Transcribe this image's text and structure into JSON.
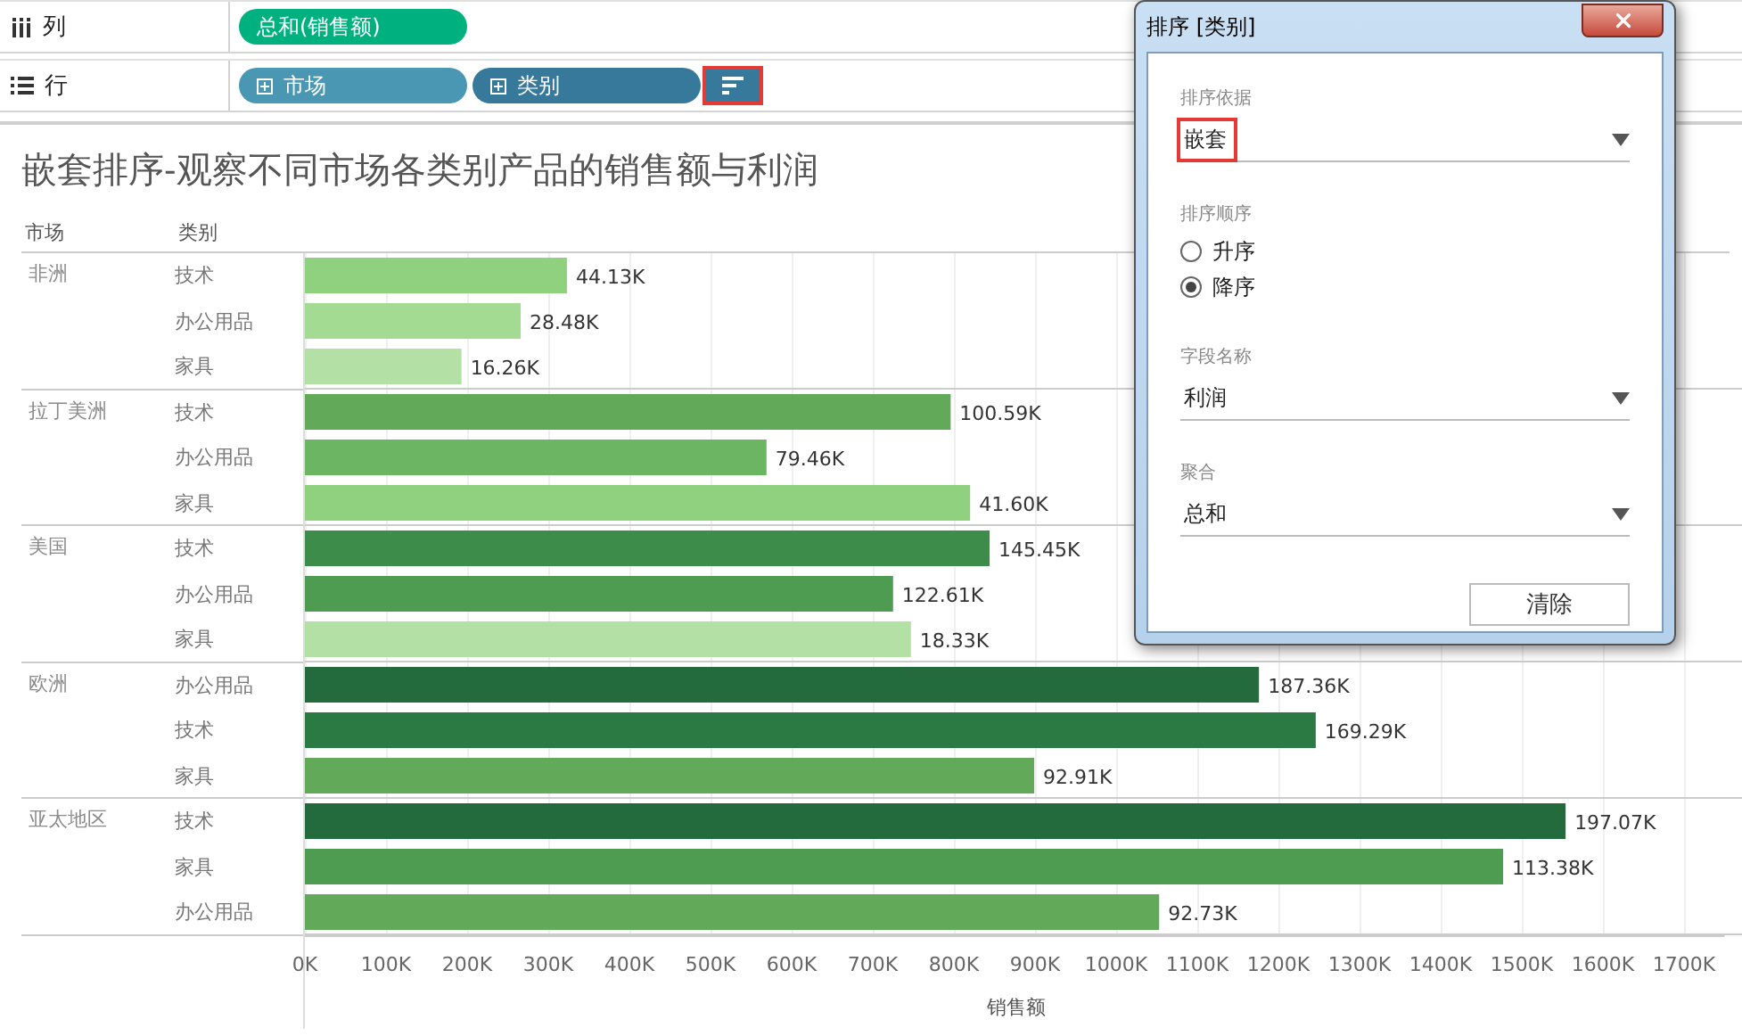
{
  "shelves": [
    {
      "kind": "columns",
      "label": "列",
      "pills": [
        {
          "text": "总和(销售额)",
          "kind": "measure",
          "sort_icon": false
        }
      ]
    },
    {
      "kind": "rows",
      "label": "行",
      "pills": [
        {
          "text": "市场",
          "kind": "dimension",
          "sort_icon": false
        },
        {
          "text": "类别",
          "kind": "dimension",
          "sort_icon": true
        }
      ]
    }
  ],
  "view": {
    "title": "嵌套排序-观察不同市场各类别产品的销售额与利润",
    "row_headers": [
      "市场",
      "类别"
    ],
    "bar_labels": [
      "44.13K",
      "28.48K",
      "16.26K",
      "100.59K",
      "79.46K",
      "41.60K",
      "145.45K",
      "122.61K",
      "18.33K",
      "187.36K",
      "169.29K",
      "92.91K",
      "197.07K",
      "113.38K",
      "92.73K"
    ],
    "groups": [
      {
        "market": "非洲",
        "categories": [
          "技术",
          "办公用品",
          "家具"
        ]
      },
      {
        "market": "拉丁美洲",
        "categories": [
          "技术",
          "办公用品",
          "家具"
        ]
      },
      {
        "market": "美国",
        "categories": [
          "技术",
          "办公用品",
          "家具"
        ]
      },
      {
        "market": "欧洲",
        "categories": [
          "办公用品",
          "技术",
          "家具"
        ]
      },
      {
        "market": "亚太地区",
        "categories": [
          "技术",
          "家具",
          "办公用品"
        ]
      }
    ],
    "chart_data": {
      "type": "bar",
      "orientation": "horizontal",
      "xlabel": "销售额",
      "values": [
        323000,
        266000,
        193000,
        796000,
        569000,
        820000,
        844000,
        725000,
        747000,
        1176000,
        1246000,
        899000,
        1554000,
        1477000,
        1053000
      ],
      "colors": [
        "#8fd17e",
        "#a3db92",
        "#b3e0a5",
        "#63a95a",
        "#6cb563",
        "#8fd17e",
        "#3d8c4a",
        "#4e9c52",
        "#b3e0a5",
        "#236b3c",
        "#2b7a43",
        "#63a95a",
        "#236b3c",
        "#4e9c52",
        "#63a95a"
      ],
      "grid": true,
      "xlim": [
        0,
        1750000
      ],
      "xticks": [
        {
          "value": 0,
          "label": "0K"
        },
        {
          "value": 100000,
          "label": "100K"
        },
        {
          "value": 200000,
          "label": "200K"
        },
        {
          "value": 300000,
          "label": "300K"
        },
        {
          "value": 400000,
          "label": "400K"
        },
        {
          "value": 500000,
          "label": "500K"
        },
        {
          "value": 600000,
          "label": "600K"
        },
        {
          "value": 700000,
          "label": "700K"
        },
        {
          "value": 800000,
          "label": "800K"
        },
        {
          "value": 900000,
          "label": "900K"
        },
        {
          "value": 1000000,
          "label": "1000K"
        },
        {
          "value": 1100000,
          "label": "1100K"
        },
        {
          "value": 1200000,
          "label": "1200K"
        },
        {
          "value": 1300000,
          "label": "1300K"
        },
        {
          "value": 1400000,
          "label": "1400K"
        },
        {
          "value": 1500000,
          "label": "1500K"
        },
        {
          "value": 1600000,
          "label": "1600K"
        },
        {
          "value": 1700000,
          "label": "1700K"
        }
      ]
    }
  },
  "dialog": {
    "title": "排序 [类别]",
    "sections": [
      {
        "kind": "select",
        "label": "排序依据",
        "value": "嵌套",
        "highlighted": true
      },
      {
        "kind": "radio",
        "label": "排序顺序",
        "options": [
          {
            "text": "升序",
            "selected": false
          },
          {
            "text": "降序",
            "selected": true
          }
        ]
      },
      {
        "kind": "select",
        "label": "字段名称",
        "value": "利润",
        "highlighted": false
      },
      {
        "kind": "select",
        "label": "聚合",
        "value": "总和",
        "highlighted": false
      }
    ],
    "button": "清除"
  }
}
